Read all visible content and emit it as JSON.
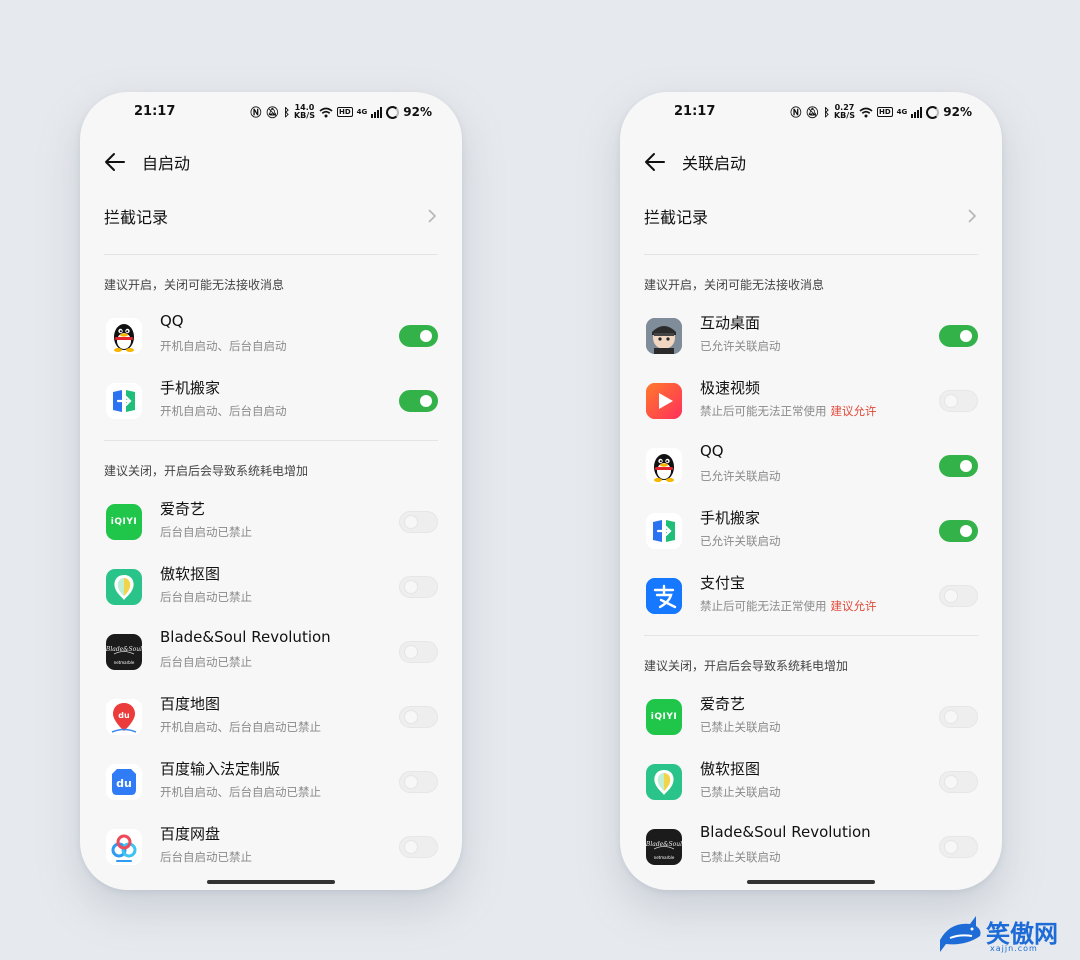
{
  "status": {
    "time": "21:17",
    "left_speed": [
      "14.0",
      "KB/S"
    ],
    "right_speed": [
      "0.27",
      "KB/S"
    ],
    "hd": "HD",
    "net": "4G",
    "battery": "92%"
  },
  "left": {
    "title": "自启动",
    "block_label": "拦截记录",
    "section1": "建议开启，关闭可能无法接收消息",
    "section2": "建议关闭，开启后会导致系统耗电增加",
    "apps1": [
      {
        "name": "QQ",
        "sub": "开机自启动、后台自启动",
        "on": true
      },
      {
        "name": "手机搬家",
        "sub": "开机自启动、后台自启动",
        "on": true
      }
    ],
    "apps2": [
      {
        "name": "爱奇艺",
        "sub": "后台自启动已禁止",
        "on": false
      },
      {
        "name": "傲软抠图",
        "sub": "后台自启动已禁止",
        "on": false
      },
      {
        "name": "Blade&Soul Revolution",
        "sub": "后台自启动已禁止",
        "on": false
      },
      {
        "name": "百度地图",
        "sub": "开机自启动、后台自启动已禁止",
        "on": false
      },
      {
        "name": "百度输入法定制版",
        "sub": "开机自启动、后台自启动已禁止",
        "on": false
      },
      {
        "name": "百度网盘",
        "sub": "后台自启动已禁止",
        "on": false
      }
    ]
  },
  "right": {
    "title": "关联启动",
    "block_label": "拦截记录",
    "section1": "建议开启，关闭可能无法接收消息",
    "section2": "建议关闭，开启后会导致系统耗电增加",
    "apps1": [
      {
        "name": "互动桌面",
        "sub": "已允许关联启动",
        "hint": "",
        "on": true
      },
      {
        "name": "极速视频",
        "sub": "禁止后可能无法正常使用",
        "hint": "建议允许",
        "on": false
      },
      {
        "name": "QQ",
        "sub": "已允许关联启动",
        "hint": "",
        "on": true
      },
      {
        "name": "手机搬家",
        "sub": "已允许关联启动",
        "hint": "",
        "on": true
      },
      {
        "name": "支付宝",
        "sub": "禁止后可能无法正常使用",
        "hint": "建议允许",
        "on": false
      }
    ],
    "apps2": [
      {
        "name": "爱奇艺",
        "sub": "已禁止关联启动",
        "on": false
      },
      {
        "name": "傲软抠图",
        "sub": "已禁止关联启动",
        "on": false
      },
      {
        "name": "Blade&Soul Revolution",
        "sub": "已禁止关联启动",
        "on": false
      }
    ]
  },
  "icons": {
    "iqiyi_text": "iQIYI",
    "bdmap_text": "du",
    "bdinput_text": "du",
    "blade_text": "Blade&Soul",
    "blade_brand": "netmarble"
  },
  "watermark": {
    "text": "笑傲网",
    "sub": "xajjn.com"
  },
  "colors": {
    "toggle_on": "#34b24a",
    "hint": "#e14b3b",
    "watermark": "#1d6bd6"
  }
}
